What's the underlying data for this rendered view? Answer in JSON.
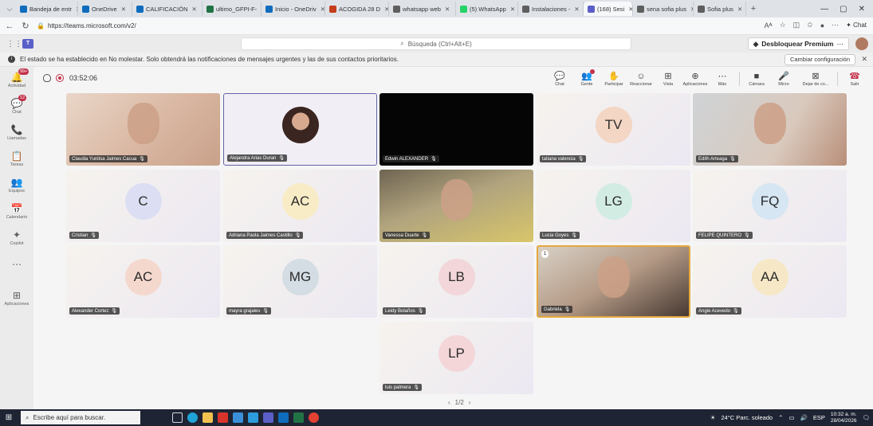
{
  "browser": {
    "tabs": [
      {
        "label": "Bandeja de entr",
        "color": "#0f6cbd"
      },
      {
        "label": "OneDrive",
        "color": "#0f6cbd"
      },
      {
        "label": "CALIFICACIÓN",
        "color": "#0f6cbd"
      },
      {
        "label": "ultimo_GFPI-F-",
        "color": "#217346"
      },
      {
        "label": "Inicio - OneDriv",
        "color": "#0f6cbd"
      },
      {
        "label": "ACOGIDA 28 D",
        "color": "#c43e1c"
      },
      {
        "label": "whatsapp web",
        "color": "#5e5e5e"
      },
      {
        "label": "(5) WhatsApp",
        "color": "#25d366"
      },
      {
        "label": "Instalaciones -",
        "color": "#5e5e5e"
      },
      {
        "label": "(168) Sesi",
        "color": "#5b5fc7"
      },
      {
        "label": "sena sofia plus",
        "color": "#5e5e5e"
      },
      {
        "label": "Sofia plus",
        "color": "#5e5e5e"
      }
    ],
    "url": "https://teams.microsoft.com/v2/",
    "copilot_label": "Chat"
  },
  "teams": {
    "search_placeholder": "Búsqueda (Ctrl+Alt+E)",
    "premium_label": "Desbloquear Premium",
    "banner_text": "El estado se ha establecido en No molestar. Solo obtendrá las notificaciones de mensajes urgentes y las de sus contactos prioritarios.",
    "banner_button": "Cambiar configuración",
    "rail": [
      {
        "label": "Actividad",
        "icon": "bell-icon",
        "glyph": "🔔",
        "badge": "99+"
      },
      {
        "label": "Chat",
        "icon": "chat-icon",
        "glyph": "💬",
        "badge": "12"
      },
      {
        "label": "Llamadas",
        "icon": "phone-icon",
        "glyph": "📞",
        "badge": ""
      },
      {
        "label": "Tareas",
        "icon": "tasks-icon",
        "glyph": "📋",
        "badge": ""
      },
      {
        "label": "Equipos",
        "icon": "teams-icon",
        "glyph": "👥",
        "badge": ""
      },
      {
        "label": "Calendario",
        "icon": "calendar-icon",
        "glyph": "📅",
        "badge": ""
      },
      {
        "label": "Copilot",
        "icon": "copilot-icon",
        "glyph": "✦",
        "badge": ""
      },
      {
        "label": "",
        "icon": "more-icon",
        "glyph": "⋯",
        "badge": ""
      },
      {
        "label": "Aplicaciones",
        "icon": "apps-icon",
        "glyph": "⊞",
        "badge": ""
      }
    ],
    "meeting": {
      "timer": "03:52:06",
      "tools": [
        {
          "label": "Chat",
          "glyph": "💬"
        },
        {
          "label": "Gente",
          "glyph": "👥"
        },
        {
          "label": "Participar",
          "glyph": "✋"
        },
        {
          "label": "Reaccionar",
          "glyph": "☺"
        },
        {
          "label": "Vista",
          "glyph": "⊞"
        },
        {
          "label": "Aplicaciones",
          "glyph": "⊕"
        },
        {
          "label": "Más",
          "glyph": "⋯"
        },
        {
          "label": "Cámara",
          "glyph": "■"
        },
        {
          "label": "Micro",
          "glyph": "🎤"
        },
        {
          "label": "Dejar de co...",
          "glyph": "⊠"
        },
        {
          "label": "Salir",
          "glyph": "☎"
        }
      ]
    },
    "participants": [
      {
        "name": "Claudia Yunitsa Jaimes Cacua",
        "initials": "",
        "kind": "video-warm"
      },
      {
        "name": "Alejandra Arias Duran",
        "initials": "",
        "kind": "photo"
      },
      {
        "name": "Edwin ALEXANDER",
        "initials": "",
        "kind": "dark"
      },
      {
        "name": "tatiana valencia",
        "initials": "TV",
        "kind": "initials",
        "color": "#f3d6c4"
      },
      {
        "name": "Edith Arteaga",
        "initials": "",
        "kind": "video-cool"
      },
      {
        "name": "Cristian",
        "initials": "C",
        "kind": "initials",
        "color": "#dcdff3"
      },
      {
        "name": "Adriana Paola Jaimes Castillo",
        "initials": "AC",
        "kind": "initials",
        "color": "#f8ecc6"
      },
      {
        "name": "Vanessa Duarte",
        "initials": "",
        "kind": "video-room"
      },
      {
        "name": "Lucia Goyes",
        "initials": "LG",
        "kind": "initials",
        "color": "#d2ece4"
      },
      {
        "name": "FELIPE QUINTERO",
        "initials": "FQ",
        "kind": "initials",
        "color": "#d6e6f3"
      },
      {
        "name": "Alexander Cortez",
        "initials": "AC",
        "kind": "initials",
        "color": "#f4d8cd"
      },
      {
        "name": "mayra grajales",
        "initials": "MG",
        "kind": "initials",
        "color": "#d4dde3"
      },
      {
        "name": "Leidy Bolaños",
        "initials": "LB",
        "kind": "initials",
        "color": "#f2d6da"
      },
      {
        "name": "Gabriela",
        "initials": "",
        "kind": "video-speaker"
      },
      {
        "name": "Angie Acevedo",
        "initials": "AA",
        "kind": "initials",
        "color": "#f6e8c6"
      },
      {
        "name": "luis palmera",
        "initials": "LP",
        "kind": "initials",
        "color": "#f4d6d9"
      }
    ],
    "speaker_reaction": "1",
    "pager": "1/2"
  },
  "taskbar": {
    "search_placeholder": "Escribe aquí para buscar.",
    "weather": "24°C Parc. soleado",
    "lang": "ESP",
    "time": "10:32 a. m.",
    "date": "28/04/2026"
  }
}
